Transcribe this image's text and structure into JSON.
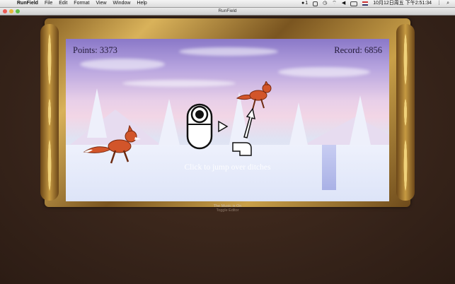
{
  "menubar": {
    "apple": "",
    "app_name": "RunField",
    "menus": [
      "File",
      "Edit",
      "Format",
      "View",
      "Window",
      "Help"
    ],
    "tray_count": "1",
    "datetime": "10月12日周五 下午2:51:34"
  },
  "window": {
    "title": "RunField"
  },
  "game": {
    "points_label": "Points: 3373",
    "record_label": "Record: 6856",
    "hint": "Click to jump over ditches"
  },
  "footer": {
    "music_status": "The Music is On",
    "toggle_editor": "Toggle Editor"
  },
  "colors": {
    "background": "#3b2519",
    "fox": "#d2552a",
    "frame_gold": "#c9a049",
    "sky": "#8a78c8"
  },
  "icons": {
    "mouse": "mouse-icon",
    "play": "play-icon",
    "arrow": "jump-arrow-icon",
    "ditch": "ditch-icon"
  }
}
